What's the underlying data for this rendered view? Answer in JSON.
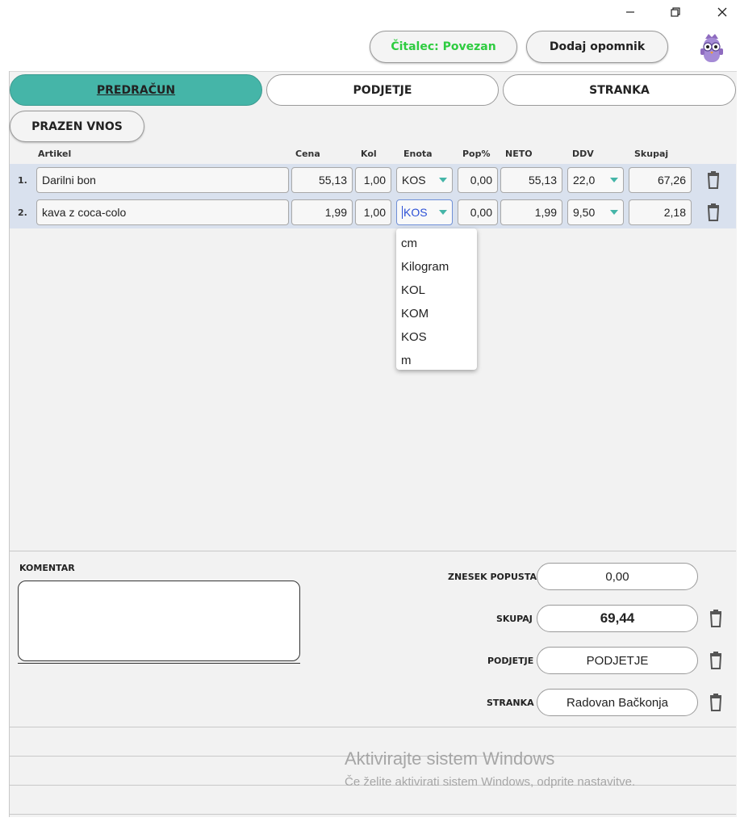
{
  "window": {
    "minimize_icon": "minimize-icon",
    "maximize_icon": "restore-icon",
    "close_icon": "close-icon"
  },
  "header": {
    "reader_status": "Čitalec: Povezan",
    "reader_status_color": "#2ecc40",
    "reminder_button": "Dodaj opomnik",
    "mascot_icon": "owl-mascot-icon"
  },
  "tabs": [
    {
      "label": "PREDRAČUN",
      "active": true
    },
    {
      "label": "PODJETJE",
      "active": false
    },
    {
      "label": "STRANKA",
      "active": false
    }
  ],
  "empty_entry_button": "PRAZEN VNOS",
  "columns": {
    "article": "Artikel",
    "price": "Cena",
    "qty": "Kol",
    "unit": "Enota",
    "discount": "Pop%",
    "net": "NETO",
    "vat": "DDV",
    "total": "Skupaj"
  },
  "rows": [
    {
      "num": "1.",
      "article": "Darilni bon",
      "price": "55,13",
      "qty": "1,00",
      "unit": "KOS",
      "discount": "0,00",
      "net": "55,13",
      "vat": "22,0",
      "total": "67,26"
    },
    {
      "num": "2.",
      "article": "kava z coca-colo",
      "price": "1,99",
      "qty": "1,00",
      "unit": "KOS",
      "discount": "0,00",
      "net": "1,99",
      "vat": "9,50",
      "total": "2,18"
    }
  ],
  "unit_dropdown": [
    "cm",
    "Kilogram",
    "KOL",
    "KOM",
    "KOS",
    "m"
  ],
  "comment": {
    "label": "KOMENTAR",
    "value": ""
  },
  "summary": {
    "discount_label": "ZNESEK POPUSTA",
    "discount_value": "0,00",
    "total_label": "SKUPAJ",
    "total_value": "69,44",
    "company_label": "PODJETJE",
    "company_value": "PODJETJE",
    "customer_label": "STRANKA",
    "customer_value": "Radovan Bačkonja"
  },
  "watermark": {
    "title": "Aktivirajte sistem Windows",
    "subtitle": "Če želite aktivirati sistem Windows, odprite nastavitve."
  },
  "colors": {
    "accent": "#45b5a8",
    "row_band": "#d9e1ee",
    "background": "#f2f2f2"
  }
}
